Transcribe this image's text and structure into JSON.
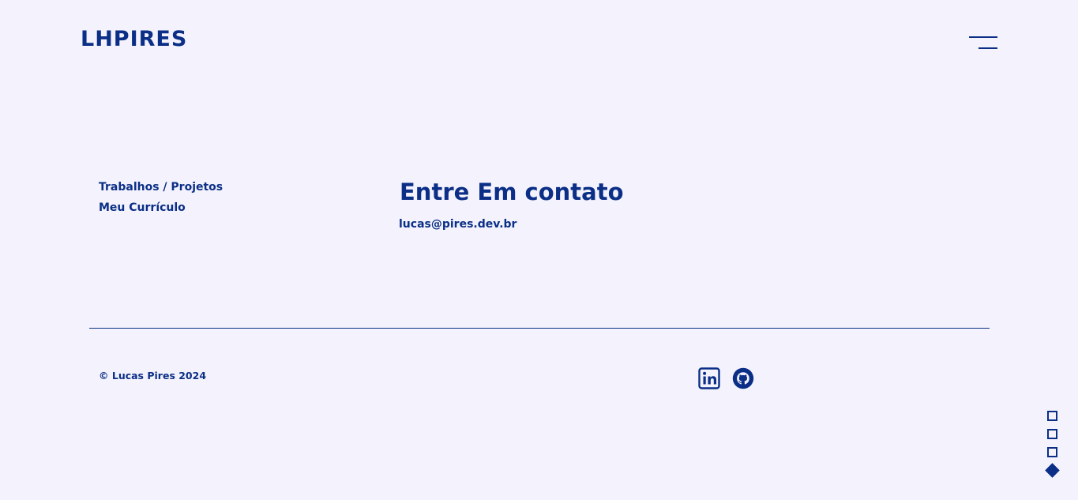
{
  "header": {
    "logo": "LHPIRES",
    "menu_icon": "hamburger-menu-icon"
  },
  "nav": {
    "items": [
      {
        "label": "Trabalhos / Projetos"
      },
      {
        "label": "Meu Currículo"
      }
    ]
  },
  "contact": {
    "title": "Entre Em contato",
    "email": "lucas@pires.dev.br"
  },
  "footer": {
    "copyright": "© Lucas Pires 2024",
    "social": [
      {
        "icon": "linkedin-icon"
      },
      {
        "icon": "github-icon"
      }
    ]
  },
  "section_nav": {
    "count": 4,
    "active_index": 3
  },
  "colors": {
    "background": "#f4f3fd",
    "accent": "#0b2f86"
  }
}
